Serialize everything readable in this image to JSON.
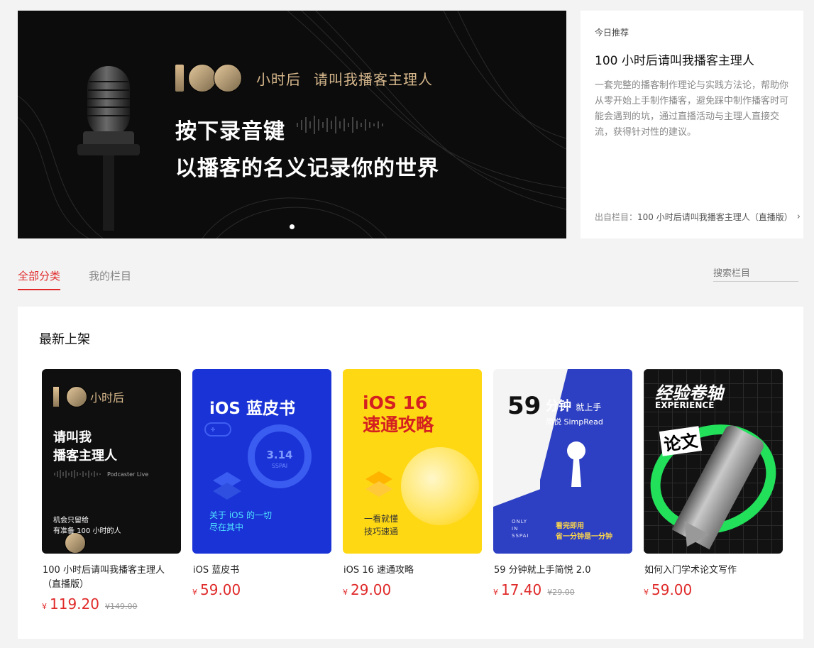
{
  "hero": {
    "logo_number": "100",
    "logo_suffix": "小时后",
    "logo_subtitle": "请叫我播客主理人",
    "line1": "按下录音键",
    "line2": "以播客的名义记录你的世界"
  },
  "recommendation": {
    "tag": "今日推荐",
    "title": "100 小时后请叫我播客主理人",
    "description": "一套完整的播客制作理论与实践方法论，帮助你从零开始上手制作播客，避免踩中制作播客时可能会遇到的坑，通过直播活动与主理人直接交流，获得针对性的建议。",
    "source_label": "出自栏目：",
    "source_value": "100 小时后请叫我播客主理人（直播版）"
  },
  "tabs": [
    {
      "label": "全部分类",
      "active": true
    },
    {
      "label": "我的栏目",
      "active": false
    }
  ],
  "search": {
    "placeholder": "搜索栏目"
  },
  "section": {
    "title": "最新上架"
  },
  "currency": "¥",
  "products": [
    {
      "name": "100 小时后请叫我播客主理人（直播版）",
      "price": "119.20",
      "original_price": "¥149.00",
      "cover": {
        "logo_suffix": "小时后",
        "title_line1": "请叫我",
        "title_line2": "播客主理人",
        "tag": "Podcaster Live",
        "bottom_line1": "机会只留给",
        "bottom_line2": "有准备 100 小时的人"
      }
    },
    {
      "name": "iOS 蓝皮书",
      "price": "59.00",
      "original_price": "",
      "cover": {
        "title": "iOS 蓝皮书",
        "version": "3.14",
        "brand": "SSPAI",
        "bottom_line1": "关于 iOS 的一切",
        "bottom_line2": "尽在其中"
      }
    },
    {
      "name": "iOS 16 速通攻略",
      "price": "29.00",
      "original_price": "",
      "cover": {
        "title_line1": "iOS 16",
        "title_line2": "速通攻略",
        "bottom_line1": "一看就懂",
        "bottom_line2": "技巧速通"
      }
    },
    {
      "name": "59 分钟就上手简悦 2.0",
      "price": "17.40",
      "original_price": "¥29.00",
      "cover": {
        "number": "59",
        "title": "分钟",
        "title_small": "就上手",
        "subtitle": "简悦 SimpRead",
        "tag_line1": "ONLY",
        "tag_line2": "IN",
        "tag_line3": "SSPAI",
        "bottom_line1": "看完即用",
        "bottom_line2": "省一分钟是一分钟"
      }
    },
    {
      "name": "如何入门学术论文写作",
      "price": "59.00",
      "original_price": "",
      "cover": {
        "title": "经验卷轴",
        "subtitle": "EXPERIENCE",
        "word": "论文"
      }
    }
  ],
  "colors": {
    "accent": "#e02a2a",
    "hero_gold": "#d6b78c"
  }
}
